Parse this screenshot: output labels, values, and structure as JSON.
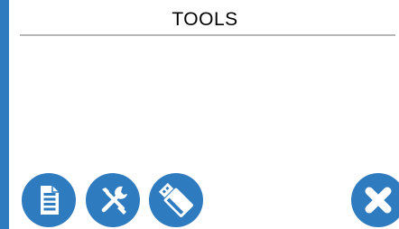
{
  "screen": {
    "title": "TOOLS"
  },
  "colors": {
    "accent": "#2f7bbf",
    "rule": "#b8b8b8",
    "background": "#ffffff"
  },
  "buttons": [
    {
      "icon": "document-icon"
    },
    {
      "icon": "tools-icon"
    },
    {
      "icon": "usb-drive-icon"
    },
    {
      "icon": "close-icon"
    }
  ]
}
